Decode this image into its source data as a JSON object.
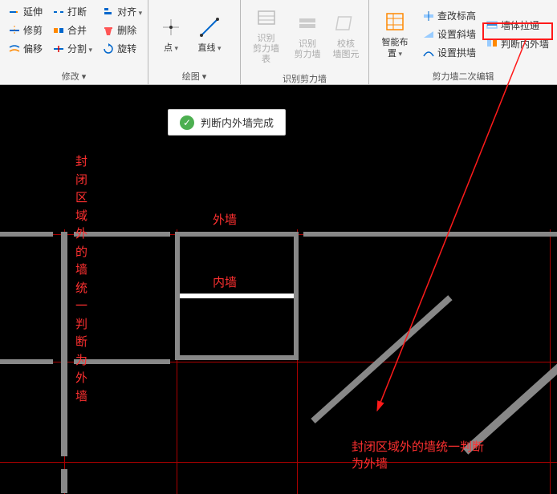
{
  "ribbon": {
    "modify": {
      "title": "修改 ▾",
      "extend": "延伸",
      "break": "打断",
      "align": "对齐",
      "trim": "修剪",
      "merge": "合并",
      "delete": "删除",
      "offset": "偏移",
      "split": "分割",
      "rotate": "旋转"
    },
    "draw": {
      "title": "绘图 ▾",
      "point": "点",
      "line": "直线"
    },
    "recognize": {
      "title": "识别剪力墙",
      "recog_table": "识别\n剪力墙表",
      "recog_wall": "识别\n剪力墙",
      "check_elem": "校核\n墙图元"
    },
    "edit": {
      "title": "剪力墙二次编辑",
      "smart": "智能布置",
      "check_elev": "查改标高",
      "wall_through": "墙体拉通",
      "set_slope": "设置斜墙",
      "judge": "判断内外墙",
      "set_arch": "设置拱墙"
    }
  },
  "toast": {
    "text": "判断内外墙完成"
  },
  "labels": {
    "outer": "外墙",
    "inner": "内墙",
    "vtext": "封闭区域外的墙统一判断为外墙",
    "bottom": "封闭区域外的墙统一判断\n为外墙"
  }
}
